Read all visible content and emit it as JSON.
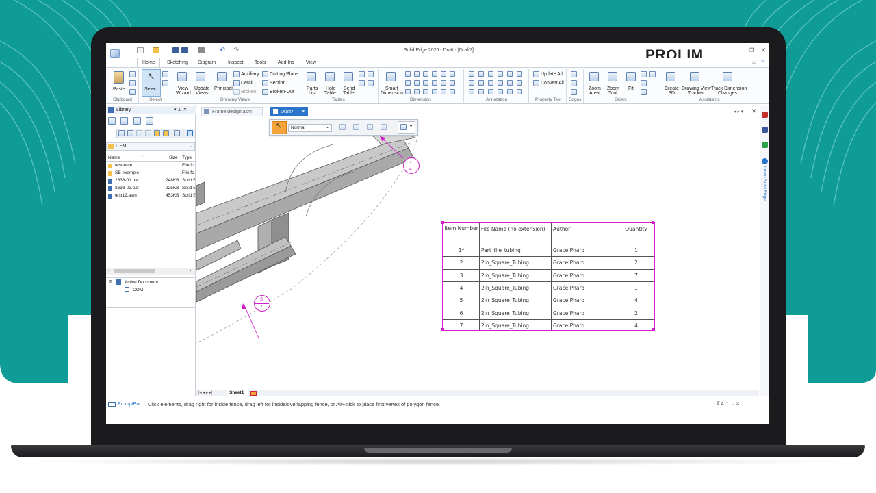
{
  "app": {
    "title": "Solid Edge 2020 - Draft - [Draft7]",
    "brand": "PROLIM"
  },
  "ribbon_tabs": [
    "Home",
    "Sketching",
    "Diagram",
    "Inspect",
    "Tools",
    "Add Ins",
    "View"
  ],
  "ribbon": {
    "clipboard": {
      "paste": "Paste",
      "label": "Clipboard"
    },
    "select": {
      "select": "Select",
      "label": "Select"
    },
    "drawing_views": {
      "view_wizard_1": "View",
      "view_wizard_2": "Wizard",
      "update_views_1": "Update",
      "update_views_2": "Views",
      "principal": "Principal",
      "auxiliary": "Auxiliary",
      "detail": "Detail",
      "broken": "Broken",
      "cutting_plane": "Cutting Plane",
      "section": "Section",
      "broken_out": "Broken-Out",
      "label": "Drawing Views"
    },
    "tables": {
      "parts_list_1": "Parts",
      "parts_list_2": "List",
      "hole_table_1": "Hole",
      "hole_table_2": "Table",
      "bend_table_1": "Bend",
      "bend_table_2": "Table",
      "label": "Tables"
    },
    "dimension": {
      "smart_1": "Smart",
      "smart_2": "Dimension",
      "label": "Dimension"
    },
    "annotation": {
      "label": "Annotation"
    },
    "property_text": {
      "update_all": "Update All",
      "convert_all": "Convert All",
      "label": "Property Text"
    },
    "edges": {
      "label": "Edges"
    },
    "orient": {
      "zoom_area_1": "Zoom",
      "zoom_area_2": "Area",
      "zoom_tool_1": "Zoom",
      "zoom_tool_2": "Tool",
      "fit": "Fit",
      "label": "Orient"
    },
    "assistants": {
      "create_3d_1": "Create",
      "create_3d_2": "3D",
      "dvt_1": "Drawing View",
      "dvt_2": "Tracker",
      "tdc_1": "Track Dimension",
      "tdc_2": "Changes",
      "label": "Assistants"
    }
  },
  "library": {
    "title": "Library",
    "path": "ITEM",
    "columns": [
      "Name",
      "Size",
      "Type"
    ],
    "files": [
      {
        "name": "resource",
        "size": "",
        "type": "File fo"
      },
      {
        "name": "SE example",
        "size": "",
        "type": "File fo"
      },
      {
        "name": "2633-01.par",
        "size": "248KB",
        "type": "Solid E"
      },
      {
        "name": "2633-02.par",
        "size": "225KB",
        "type": "Solid E"
      },
      {
        "name": "test12.asm",
        "size": "453KB",
        "type": "Solid E"
      }
    ],
    "tree": {
      "root": "Active Document",
      "child": "COM"
    }
  },
  "doc_tabs": [
    "Frame design.asm",
    "Draft7"
  ],
  "float_toolbar": {
    "mode": "Normal"
  },
  "sheet_tab": "Sheet1",
  "balloons": [
    {
      "top": "7",
      "bottom": "4"
    },
    {
      "top": "3",
      "bottom": "7"
    }
  ],
  "parts_table": {
    "headers": [
      "Item Number",
      "File Name (no extension)",
      "Author",
      "Quantity"
    ],
    "rows": [
      {
        "item": "1*",
        "file": "Part_file_tubing",
        "author": "Grace Pharo",
        "qty": "1"
      },
      {
        "item": "2",
        "file": "2in_Square_Tubing",
        "author": "Grace Pharo",
        "qty": "2"
      },
      {
        "item": "3",
        "file": "2in_Square_Tubing",
        "author": "Grace Pharo",
        "qty": "7"
      },
      {
        "item": "4",
        "file": "2in_Square_Tubing",
        "author": "Grace Pharo",
        "qty": "1"
      },
      {
        "item": "5",
        "file": "2in_Square_Tubing",
        "author": "Grace Pharo",
        "qty": "4"
      },
      {
        "item": "6",
        "file": "2in_Square_Tubing",
        "author": "Grace Pharo",
        "qty": "2"
      },
      {
        "item": "7",
        "file": "2in_Square_Tubing",
        "author": "Grace Pharo",
        "qty": "4"
      }
    ]
  },
  "prompt_bar": {
    "label": "PromptBar",
    "message": "Click elements, drag right for inside fence, drag left for inside/overlapping fence, or Alt+click to place first vertex of polygon fence."
  },
  "right_panel": {
    "text": "Learn Solid Edge"
  },
  "colors": {
    "teal": "#0f9b96",
    "accent_blue": "#2a74c9",
    "annotation_magenta": "#d21fc8",
    "laptop": "#1b1b1d"
  }
}
